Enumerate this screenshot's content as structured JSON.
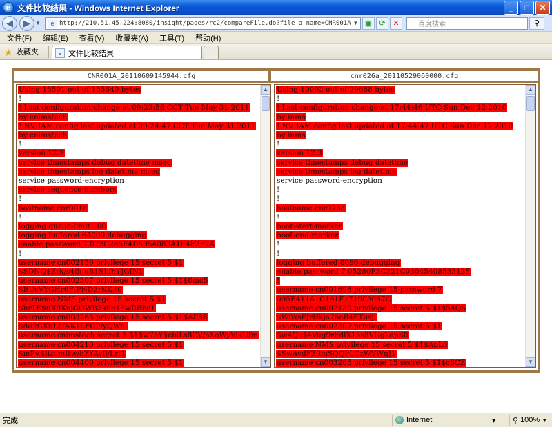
{
  "window": {
    "title": "文件比较结果 - Windows Internet Explorer"
  },
  "address": {
    "url": "http://210.51.45.224:8080/insight/pages/rc2/compareFile.do?file_a_name=CNR001A_20110609145944",
    "search_placeholder": "百度搜索"
  },
  "menu": [
    "文件(F)",
    "编辑(E)",
    "查看(V)",
    "收藏夹(A)",
    "工具(T)",
    "帮助(H)"
  ],
  "favorites": {
    "label": "收藏夹"
  },
  "tab": {
    "label": "文件比较结果"
  },
  "compare": {
    "left_file": "CNR001A_20110609145944.cfg",
    "right_file": "cnr026a_20110529060000.cfg",
    "left_lines": [
      {
        "t": "Using 15501 out of 155640 bytes",
        "d": true
      },
      {
        "t": "!",
        "d": false
      },
      {
        "t": "! Last configuration change at 09:23:58 CCT Tue May 31 2011",
        "d": true
      },
      {
        "t": "by cnimstech",
        "d": true
      },
      {
        "t": "! NVRAM config last updated at 09:24:47 CCT Tue May 31 2011",
        "d": true
      },
      {
        "t": "by cnimstech",
        "d": true
      },
      {
        "t": "!",
        "d": false
      },
      {
        "t": "version 12.2",
        "d": true
      },
      {
        "t": "service timestamps debug datetime msec",
        "d": true
      },
      {
        "t": "service timestamps log datetime msec",
        "d": true
      },
      {
        "t": "service password-encryption",
        "d": false
      },
      {
        "t": "service sequence-numbers",
        "d": true
      },
      {
        "t": "!",
        "d": false
      },
      {
        "t": "hostname cnr001a",
        "d": true
      },
      {
        "t": "!",
        "d": false
      },
      {
        "t": "logging queue-limit 100",
        "d": true
      },
      {
        "t": "logging buffered 64000 debugging",
        "d": true
      },
      {
        "t": "enable password 7 072C285F4D5954083A1F4F2F2A",
        "d": true
      },
      {
        "t": "!",
        "d": false
      },
      {
        "t": "username cn002139 privilege 15 secret 5 $1",
        "d": true
      },
      {
        "t": "$SDNQ$Zrk/s4fh.uB1SLfhYJGIN1",
        "d": true
      },
      {
        "t": "username cn002307 privilege 15 secret 5 $1$6mc5",
        "d": true
      },
      {
        "t": "$BUsVYGHr6FfPND3rKK.t0",
        "d": true
      },
      {
        "t": "username NMS privilege 15 secret 5 $1",
        "d": true
      },
      {
        "t": "$hrTE$uKdXnjGOWB3k6n15wRBbc1",
        "d": true
      },
      {
        "t": "username cn003265 privilege 15 secret 5 $1$AP38",
        "d": true
      },
      {
        "t": "$dd2GXbL3fAK1LFGP/yQWu.",
        "d": true
      },
      {
        "t": "username cnimstech secret 5 $1$w75Y$ebiLs8CV/aXoWyVikUfml",
        "d": true
      },
      {
        "t": "username cn004210 privilege 15 secret 5 $1",
        "d": true
      },
      {
        "t": "$mPy.$lizumItw/hZYAyfj/Lrt1",
        "d": true
      },
      {
        "t": "username cn004400 privilege 15 secret 5 $1",
        "d": true
      }
    ],
    "right_lines": [
      {
        "t": "Using 10092 out of 29688 bytes",
        "d": true
      },
      {
        "t": "!",
        "d": false
      },
      {
        "t": "! Last configuration change at 17:44:46 UTC Sun Dec 12 2010",
        "d": true
      },
      {
        "t": "by inms",
        "d": true
      },
      {
        "t": "! NVRAM config last updated at 17:44:47 UTC Sun Dec 12 2010",
        "d": true
      },
      {
        "t": "by inms",
        "d": true
      },
      {
        "t": "!",
        "d": false
      },
      {
        "t": "version 12.3",
        "d": true
      },
      {
        "t": "service timestamps debug datetime",
        "d": true
      },
      {
        "t": "service timestamps log datetime",
        "d": true
      },
      {
        "t": "service password-encryption",
        "d": false
      },
      {
        "t": "!",
        "d": false
      },
      {
        "t": "!",
        "d": false
      },
      {
        "t": "hostname cnr026a",
        "d": true
      },
      {
        "t": "!",
        "d": false
      },
      {
        "t": "boot-start-marker",
        "d": true
      },
      {
        "t": "boot-end-marker",
        "d": true
      },
      {
        "t": "!",
        "d": false
      },
      {
        "t": "!",
        "d": false
      },
      {
        "t": "logging buffered 8096 debugging",
        "d": true
      },
      {
        "t": "enable password 7 05280F3C221C03045408533125",
        "d": true
      },
      {
        "t": "!",
        "d": true
      },
      {
        "t": "username cn001698 privilege 15 password 7",
        "d": true
      },
      {
        "t": "095E411A1C161F171903087C",
        "d": true
      },
      {
        "t": "username cn002139 privilege 15 secret 5 $1$54Q6",
        "d": true
      },
      {
        "t": "$W0xsFJrHkja76aB4FTusj.",
        "d": true
      },
      {
        "t": "username cn002307 privilege 15 secret 5 $1",
        "d": true
      },
      {
        "t": "$w4Qu$4Vug9rFdlX15s8VUg2dpS0",
        "d": true
      },
      {
        "t": "username NMS privilege 15 secret 5 $1$ApL0",
        "d": true
      },
      {
        "t": "$SwAvdFZ0mSQQPLCzWVWqJ1",
        "d": true
      },
      {
        "t": "username cn003265 privilege 15 secret 5 $1$c8CZ",
        "d": true
      }
    ]
  },
  "status": {
    "text": "完成",
    "zone": "Internet",
    "zoom": "100%"
  }
}
